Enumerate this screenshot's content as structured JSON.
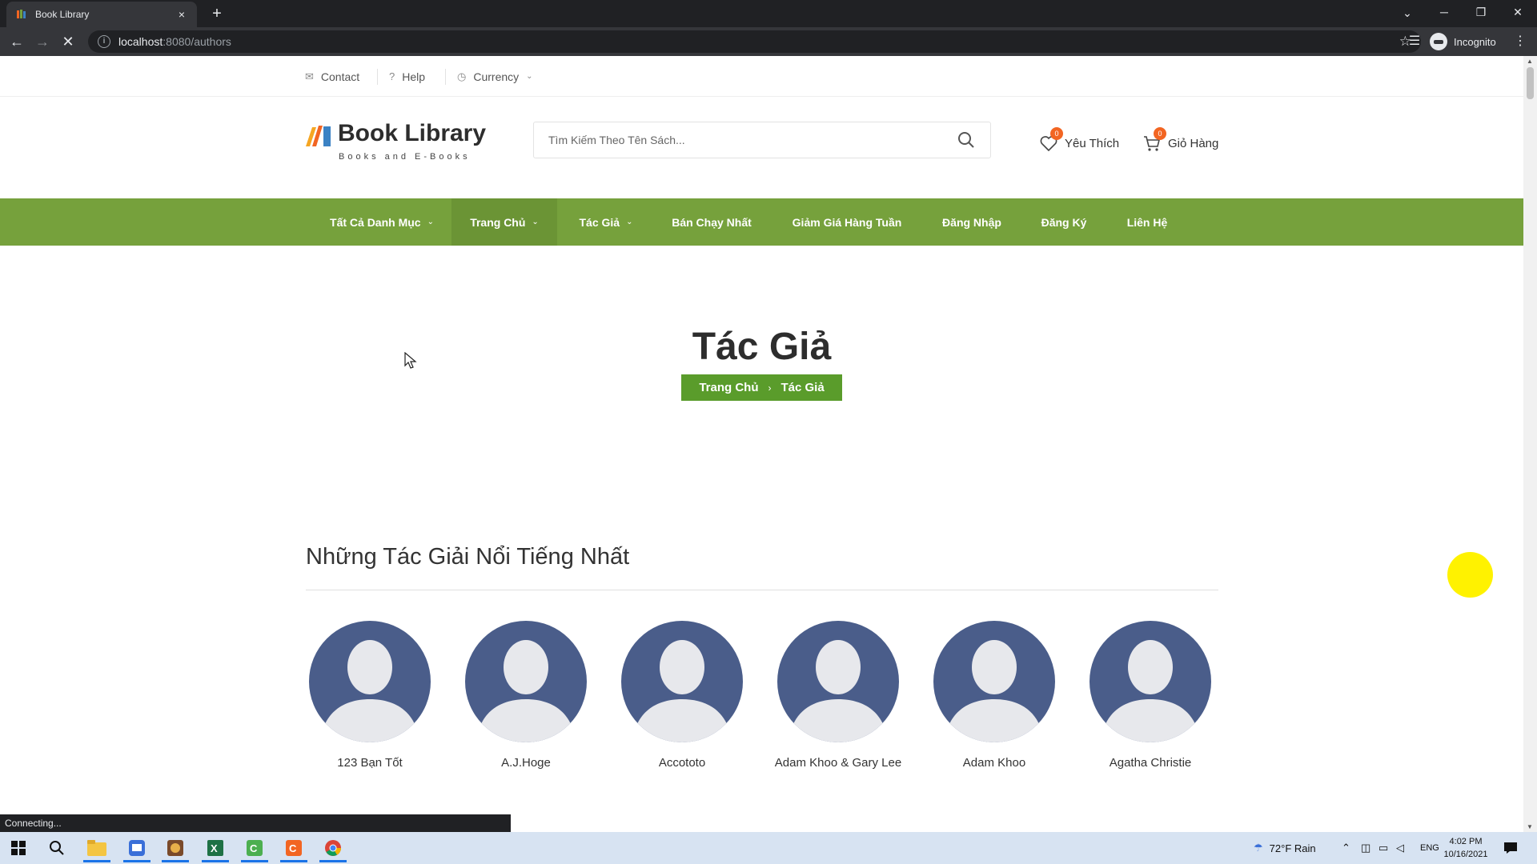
{
  "browser": {
    "tab_title": "Book Library",
    "tab_close": "×",
    "new_tab": "+",
    "url_host": "localhost",
    "url_path": ":8080/authors",
    "profile_label": "Incognito",
    "status_text": "Connecting..."
  },
  "topbar": {
    "contact": "Contact",
    "help": "Help",
    "currency": "Currency"
  },
  "header": {
    "logo_title": "Book Library",
    "logo_subtitle": "Books and E-Books",
    "search_placeholder": "Tìm Kiếm Theo Tên Sách...",
    "wishlist_label": "Yêu Thích",
    "wishlist_count": "0",
    "cart_label": "Giỏ Hàng",
    "cart_count": "0"
  },
  "nav": {
    "items": [
      {
        "label": "Tất Cả Danh Mục"
      },
      {
        "label": "Trang Chủ"
      },
      {
        "label": "Tác Giả"
      },
      {
        "label": "Bán Chạy Nhất"
      },
      {
        "label": "Giảm Giá Hàng Tuần"
      },
      {
        "label": "Đăng Nhập"
      },
      {
        "label": "Đăng Ký"
      },
      {
        "label": "Liên Hệ"
      }
    ]
  },
  "page": {
    "title": "Tác Giả",
    "breadcrumb_home": "Trang Chủ",
    "breadcrumb_sep": "›",
    "breadcrumb_current": "Tác Giả",
    "section_title": "Những Tác Giải Nổi Tiếng Nhất"
  },
  "authors": [
    {
      "name": "123 Bạn Tốt"
    },
    {
      "name": "A.J.Hoge"
    },
    {
      "name": "Accototo"
    },
    {
      "name": "Adam Khoo & Gary Lee"
    },
    {
      "name": "Adam Khoo"
    },
    {
      "name": "Agatha Christie"
    }
  ],
  "taskbar": {
    "weather": "72°F  Rain",
    "language": "ENG",
    "time": "4:02 PM",
    "date": "10/16/2021"
  },
  "colors": {
    "nav_green": "#76a13c",
    "breadcrumb_green": "#5a9c2b",
    "badge_orange": "#f26522",
    "avatar_blue": "#4a5d8a",
    "highlight_yellow": "#fff200"
  }
}
